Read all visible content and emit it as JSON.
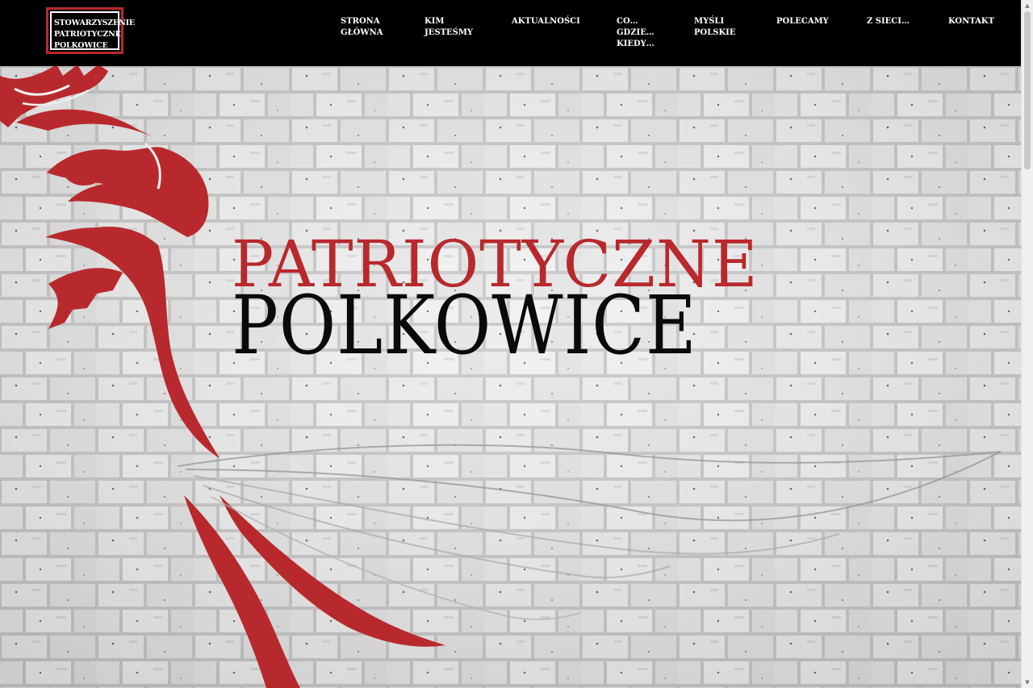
{
  "logo": {
    "lines": [
      "STOWARZYSZENIE",
      "PATRIOTYCZNE",
      "POLKOWICE"
    ]
  },
  "nav": [
    {
      "lines": [
        "STRONA",
        "GŁÓWNA"
      ]
    },
    {
      "lines": [
        "KIM",
        "JESTEŚMY"
      ]
    },
    {
      "lines": [
        "AKTUALNOŚCI"
      ]
    },
    {
      "lines": [
        "CO…",
        "GDZIE…",
        "KIEDY…"
      ]
    },
    {
      "lines": [
        "MYŚLI",
        "POLSKIE"
      ]
    },
    {
      "lines": [
        "POLECAMY"
      ]
    },
    {
      "lines": [
        "Z SIECI…"
      ]
    },
    {
      "lines": [
        "KONTAKT"
      ]
    }
  ],
  "hero": {
    "title_line1": "PATRIOTYCZNE",
    "title_line2": "POLKOWICE"
  },
  "colors": {
    "accent": "#b8292d",
    "topbar": "#000000",
    "brick": "#e6e6e6",
    "mortar": "#bdbdbd",
    "title_dark": "#0a0a0a"
  },
  "icons": {
    "background": "white-brick-wall",
    "emblem": "polish-white-eagle-emblem",
    "scroll_up": "chevron-up-icon",
    "scroll_down": "chevron-down-icon"
  }
}
